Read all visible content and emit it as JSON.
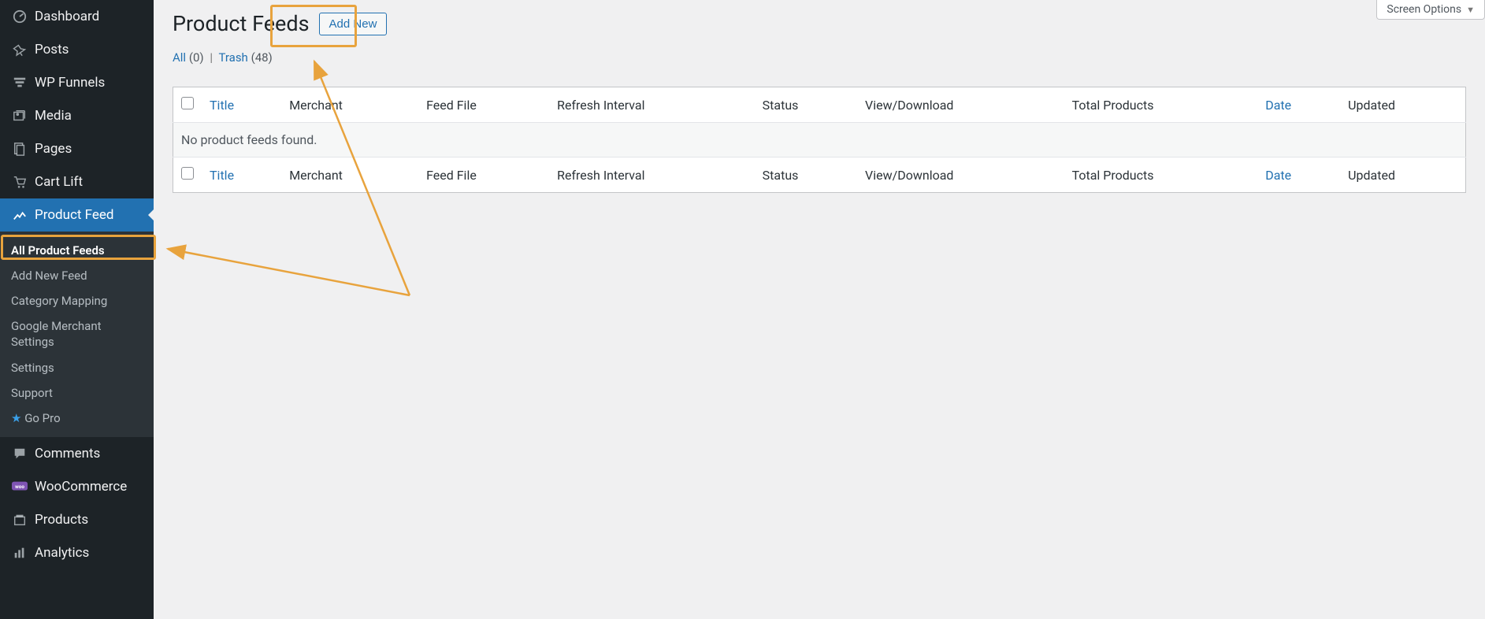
{
  "sidebar": {
    "dashboard": "Dashboard",
    "posts": "Posts",
    "wpfunnels": "WP Funnels",
    "media": "Media",
    "pages": "Pages",
    "cartlift": "Cart Lift",
    "productfeed": "Product Feed",
    "comments": "Comments",
    "woocommerce": "WooCommerce",
    "products": "Products",
    "analytics": "Analytics",
    "sub": {
      "all": "All Product Feeds",
      "addnew": "Add New Feed",
      "category": "Category Mapping",
      "gmerchant": "Google Merchant Settings",
      "settings": "Settings",
      "support": "Support",
      "gopro": "Go Pro"
    }
  },
  "header": {
    "title": "Product Feeds",
    "add_new": "Add New",
    "screen_options": "Screen Options"
  },
  "subsub": {
    "all_label": "All",
    "all_count": "(0)",
    "trash_label": "Trash",
    "trash_count": "(48)"
  },
  "table": {
    "cols": {
      "title": "Title",
      "merchant": "Merchant",
      "feedfile": "Feed File",
      "refresh": "Refresh Interval",
      "status": "Status",
      "viewdl": "View/Download",
      "total": "Total Products",
      "date": "Date",
      "updated": "Updated"
    },
    "empty": "No product feeds found."
  }
}
